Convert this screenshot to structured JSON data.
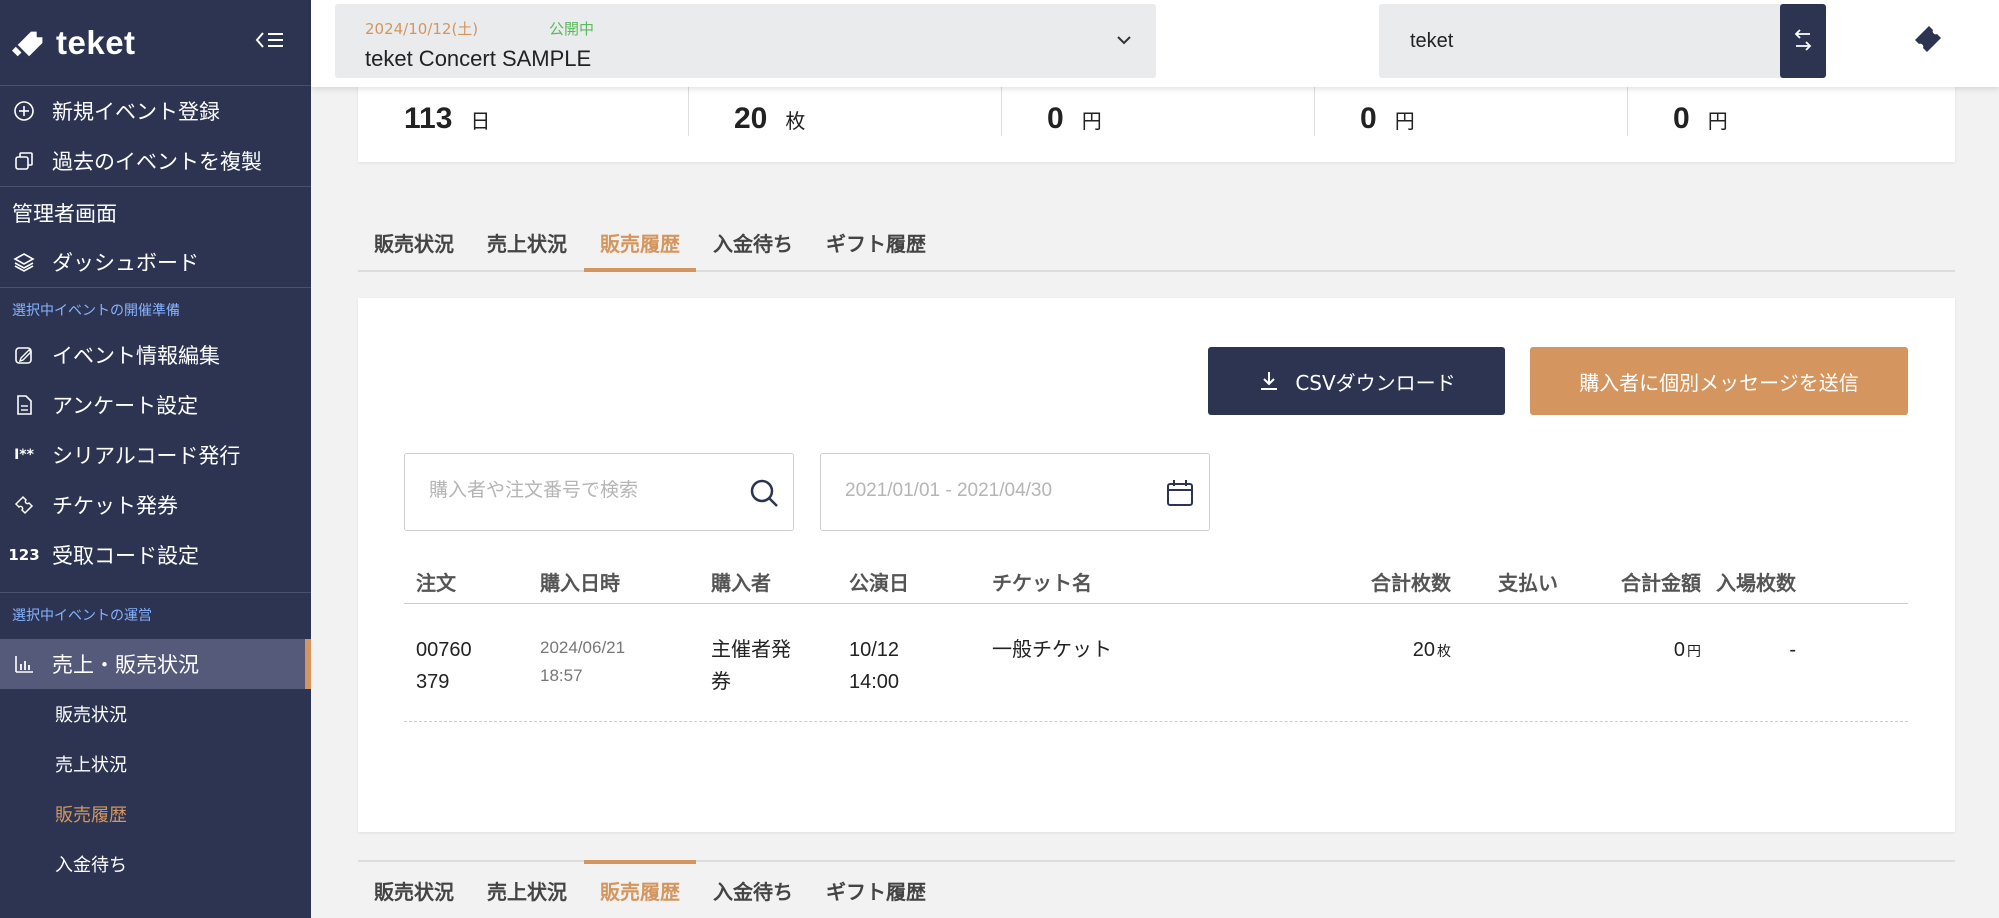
{
  "brand": {
    "logo_text": "teket",
    "accent": "#d4965e",
    "navy": "#2c3452"
  },
  "sidebar": {
    "top_items": [
      {
        "label": "新規イベント登録",
        "icon": "plus-circle-icon"
      },
      {
        "label": "過去のイベントを複製",
        "icon": "copy-icon"
      }
    ],
    "admin_heading": "管理者画面",
    "dashboard": {
      "label": "ダッシュボード",
      "icon": "layers-icon"
    },
    "prep_section_label": "選択中イベントの開催準備",
    "prep_items": [
      {
        "label": "イベント情報編集",
        "icon": "edit-icon"
      },
      {
        "label": "アンケート設定",
        "icon": "document-icon"
      },
      {
        "label": "シリアルコード発行",
        "icon": "serial-code-icon"
      },
      {
        "label": "チケット発券",
        "icon": "ticket-tag-icon"
      },
      {
        "label": "受取コード設定",
        "icon": "number-123-icon"
      }
    ],
    "ops_section_label": "選択中イベントの運営",
    "ops_active": {
      "label": "売上・販売状況",
      "icon": "bar-chart-icon"
    },
    "sub_items": [
      "販売状況",
      "売上状況",
      "販売履歴",
      "入金待ち"
    ],
    "current_sub": "販売履歴"
  },
  "topbar": {
    "event_date": "2024/10/12(土)",
    "event_status": "公開中",
    "event_name": "teket Concert SAMPLE",
    "org_name": "teket"
  },
  "stats": [
    {
      "value": "113",
      "unit": "日"
    },
    {
      "value": "20",
      "unit": "枚"
    },
    {
      "value": "0",
      "unit": "円"
    },
    {
      "value": "0",
      "unit": "円"
    },
    {
      "value": "0",
      "unit": "円"
    }
  ],
  "tabs": [
    "販売状況",
    "売上状況",
    "販売履歴",
    "入金待ち",
    "ギフト履歴"
  ],
  "active_tab": "販売履歴",
  "actions": {
    "csv_label": "CSVダウンロード",
    "message_label": "購入者に個別メッセージを送信"
  },
  "filters": {
    "search_placeholder": "購入者や注文番号で検索",
    "date_placeholder": "2021/01/01 - 2021/04/30"
  },
  "table": {
    "headers": [
      "注文",
      "購入日時",
      "購入者",
      "公演日",
      "チケット名",
      "合計枚数",
      "支払い",
      "合計金額",
      "入場枚数"
    ],
    "rows": [
      {
        "order_line1": "00760",
        "order_line2": "379",
        "purchased_line1": "2024/06/21",
        "purchased_line2": "18:57",
        "buyer_line1": "主催者発",
        "buyer_line2": "券",
        "show_line1": "10/12",
        "show_line2": "14:00",
        "ticket_name": "一般チケット",
        "qty": "20",
        "qty_unit": "枚",
        "payment": "",
        "amount": "0",
        "amount_unit": "円",
        "entered": "-"
      }
    ]
  }
}
